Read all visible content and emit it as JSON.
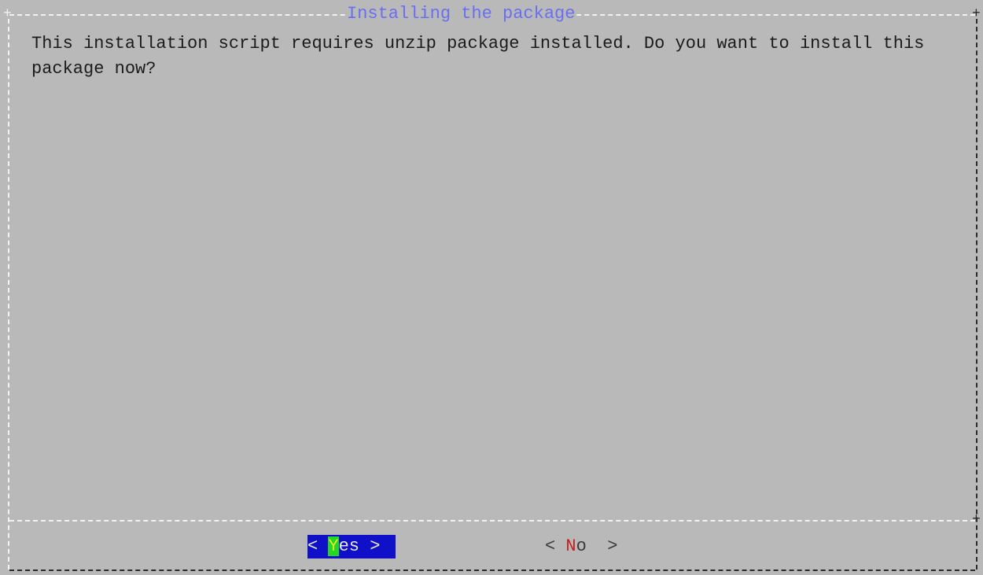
{
  "dialog": {
    "title": "Installing the package",
    "message": "This installation script requires unzip package installed. Do you want to install this package now?",
    "buttons": {
      "yes": {
        "left_bracket": "< ",
        "hotkey": "Y",
        "rest": "es",
        "right_bracket": " >",
        "selected": true
      },
      "no": {
        "left_bracket": "< ",
        "hotkey": "N",
        "rest": "o",
        "right_bracket": "  >",
        "selected": false
      }
    }
  },
  "colors": {
    "background": "#b9b9b9",
    "border_light": "#f2f2f2",
    "border_dark": "#2a2a2a",
    "title": "#6a6ef2",
    "text": "#1b1b1b",
    "selected_button_bg": "#1010c8",
    "selected_hotkey_bg": "#22d822",
    "hotkey_fg": "#c41f1f"
  }
}
